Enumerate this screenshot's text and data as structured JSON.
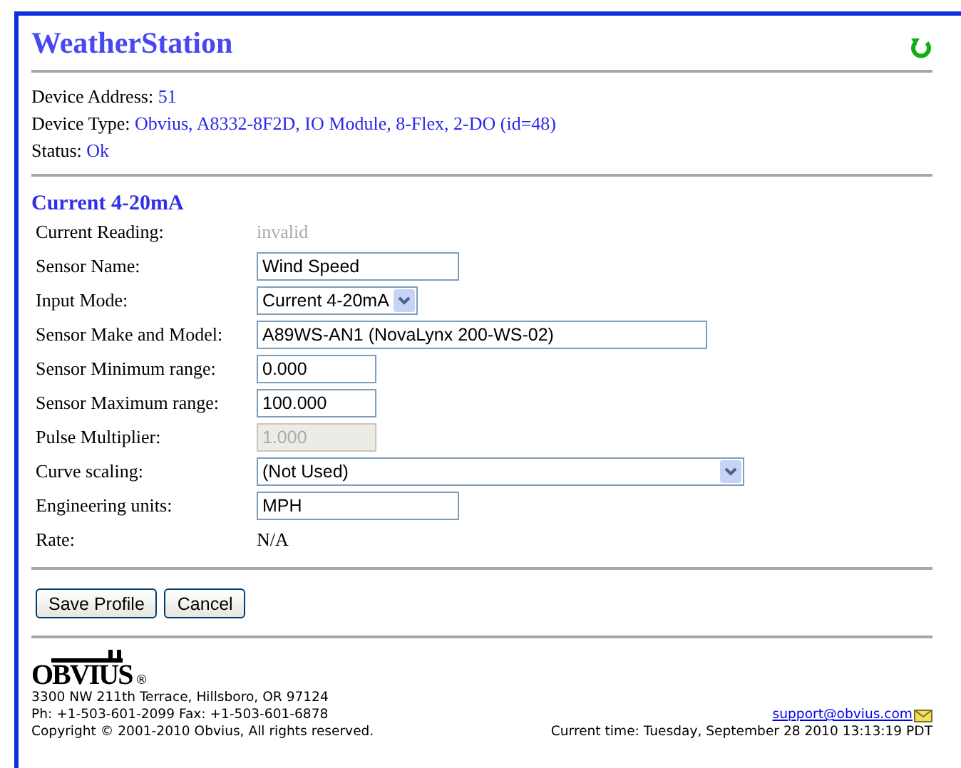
{
  "title": "WeatherStation",
  "device": [
    {
      "label": "Device Address:",
      "value": "51"
    },
    {
      "label": "Device Type:",
      "value": "Obvius, A8332-8F2D, IO Module, 8-Flex, 2-DO (id=48)"
    },
    {
      "label": "Status:",
      "value": "Ok"
    }
  ],
  "section": "Current 4-20mA",
  "fields": [
    {
      "label": "Current Reading:",
      "kind": "static",
      "value": "invalid",
      "disabled": true
    },
    {
      "label": "Sensor Name:",
      "kind": "input",
      "value": "Wind Speed",
      "disabled": false
    },
    {
      "label": "Input Mode:",
      "kind": "select",
      "value": "Current 4-20mA",
      "disabled": false
    },
    {
      "label": "Sensor Make and Model:",
      "kind": "input",
      "value": "A89WS-AN1 (NovaLynx 200-WS-02)",
      "disabled": false
    },
    {
      "label": "Sensor Minimum range:",
      "kind": "input",
      "value": "0.000",
      "disabled": false
    },
    {
      "label": "Sensor Maximum range:",
      "kind": "input",
      "value": "100.000",
      "disabled": false
    },
    {
      "label": "Pulse Multiplier:",
      "kind": "input",
      "value": "1.000",
      "disabled": true
    },
    {
      "label": "Curve scaling:",
      "kind": "select",
      "value": "(Not Used)",
      "disabled": false
    },
    {
      "label": "Engineering units:",
      "kind": "input",
      "value": "MPH",
      "disabled": false
    },
    {
      "label": "Rate:",
      "kind": "static",
      "value": "N/A",
      "disabled": false
    }
  ],
  "buttons": [
    "Save Profile",
    "Cancel"
  ],
  "footer": {
    "logo": "OBVIUS",
    "registered": "®",
    "address": [
      "3300 NW 211th Terrace, Hillsboro, OR 97124",
      "Ph: +1-503-601-2099 Fax: +1-503-601-6878",
      "Copyright © 2001-2010 Obvius, All rights reserved."
    ],
    "email": "support@obvius.com",
    "time": "Current time: Tuesday, September 28 2010 13:13:19 PDT"
  }
}
